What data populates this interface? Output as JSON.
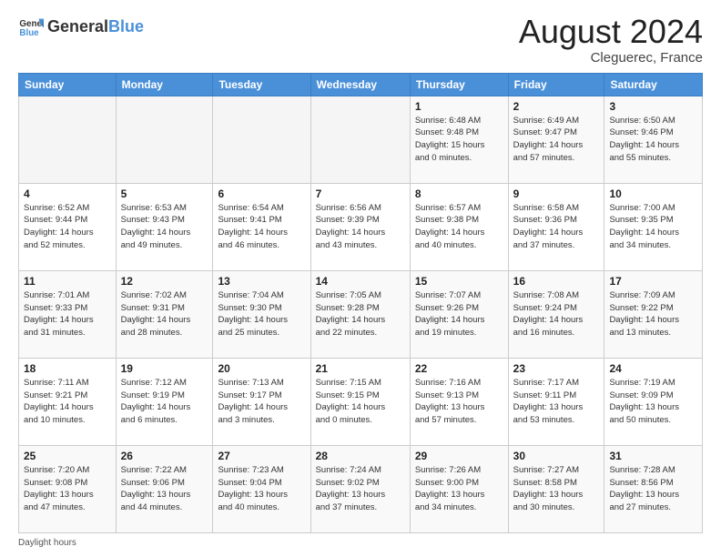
{
  "header": {
    "logo_general": "General",
    "logo_blue": "Blue",
    "month_year": "August 2024",
    "location": "Cleguerec, France"
  },
  "days_of_week": [
    "Sunday",
    "Monday",
    "Tuesday",
    "Wednesday",
    "Thursday",
    "Friday",
    "Saturday"
  ],
  "footer": {
    "daylight_label": "Daylight hours"
  },
  "weeks": [
    {
      "days": [
        {
          "num": "",
          "info": ""
        },
        {
          "num": "",
          "info": ""
        },
        {
          "num": "",
          "info": ""
        },
        {
          "num": "",
          "info": ""
        },
        {
          "num": "1",
          "info": "Sunrise: 6:48 AM\nSunset: 9:48 PM\nDaylight: 15 hours\nand 0 minutes."
        },
        {
          "num": "2",
          "info": "Sunrise: 6:49 AM\nSunset: 9:47 PM\nDaylight: 14 hours\nand 57 minutes."
        },
        {
          "num": "3",
          "info": "Sunrise: 6:50 AM\nSunset: 9:46 PM\nDaylight: 14 hours\nand 55 minutes."
        }
      ]
    },
    {
      "days": [
        {
          "num": "4",
          "info": "Sunrise: 6:52 AM\nSunset: 9:44 PM\nDaylight: 14 hours\nand 52 minutes."
        },
        {
          "num": "5",
          "info": "Sunrise: 6:53 AM\nSunset: 9:43 PM\nDaylight: 14 hours\nand 49 minutes."
        },
        {
          "num": "6",
          "info": "Sunrise: 6:54 AM\nSunset: 9:41 PM\nDaylight: 14 hours\nand 46 minutes."
        },
        {
          "num": "7",
          "info": "Sunrise: 6:56 AM\nSunset: 9:39 PM\nDaylight: 14 hours\nand 43 minutes."
        },
        {
          "num": "8",
          "info": "Sunrise: 6:57 AM\nSunset: 9:38 PM\nDaylight: 14 hours\nand 40 minutes."
        },
        {
          "num": "9",
          "info": "Sunrise: 6:58 AM\nSunset: 9:36 PM\nDaylight: 14 hours\nand 37 minutes."
        },
        {
          "num": "10",
          "info": "Sunrise: 7:00 AM\nSunset: 9:35 PM\nDaylight: 14 hours\nand 34 minutes."
        }
      ]
    },
    {
      "days": [
        {
          "num": "11",
          "info": "Sunrise: 7:01 AM\nSunset: 9:33 PM\nDaylight: 14 hours\nand 31 minutes."
        },
        {
          "num": "12",
          "info": "Sunrise: 7:02 AM\nSunset: 9:31 PM\nDaylight: 14 hours\nand 28 minutes."
        },
        {
          "num": "13",
          "info": "Sunrise: 7:04 AM\nSunset: 9:30 PM\nDaylight: 14 hours\nand 25 minutes."
        },
        {
          "num": "14",
          "info": "Sunrise: 7:05 AM\nSunset: 9:28 PM\nDaylight: 14 hours\nand 22 minutes."
        },
        {
          "num": "15",
          "info": "Sunrise: 7:07 AM\nSunset: 9:26 PM\nDaylight: 14 hours\nand 19 minutes."
        },
        {
          "num": "16",
          "info": "Sunrise: 7:08 AM\nSunset: 9:24 PM\nDaylight: 14 hours\nand 16 minutes."
        },
        {
          "num": "17",
          "info": "Sunrise: 7:09 AM\nSunset: 9:22 PM\nDaylight: 14 hours\nand 13 minutes."
        }
      ]
    },
    {
      "days": [
        {
          "num": "18",
          "info": "Sunrise: 7:11 AM\nSunset: 9:21 PM\nDaylight: 14 hours\nand 10 minutes."
        },
        {
          "num": "19",
          "info": "Sunrise: 7:12 AM\nSunset: 9:19 PM\nDaylight: 14 hours\nand 6 minutes."
        },
        {
          "num": "20",
          "info": "Sunrise: 7:13 AM\nSunset: 9:17 PM\nDaylight: 14 hours\nand 3 minutes."
        },
        {
          "num": "21",
          "info": "Sunrise: 7:15 AM\nSunset: 9:15 PM\nDaylight: 14 hours\nand 0 minutes."
        },
        {
          "num": "22",
          "info": "Sunrise: 7:16 AM\nSunset: 9:13 PM\nDaylight: 13 hours\nand 57 minutes."
        },
        {
          "num": "23",
          "info": "Sunrise: 7:17 AM\nSunset: 9:11 PM\nDaylight: 13 hours\nand 53 minutes."
        },
        {
          "num": "24",
          "info": "Sunrise: 7:19 AM\nSunset: 9:09 PM\nDaylight: 13 hours\nand 50 minutes."
        }
      ]
    },
    {
      "days": [
        {
          "num": "25",
          "info": "Sunrise: 7:20 AM\nSunset: 9:08 PM\nDaylight: 13 hours\nand 47 minutes."
        },
        {
          "num": "26",
          "info": "Sunrise: 7:22 AM\nSunset: 9:06 PM\nDaylight: 13 hours\nand 44 minutes."
        },
        {
          "num": "27",
          "info": "Sunrise: 7:23 AM\nSunset: 9:04 PM\nDaylight: 13 hours\nand 40 minutes."
        },
        {
          "num": "28",
          "info": "Sunrise: 7:24 AM\nSunset: 9:02 PM\nDaylight: 13 hours\nand 37 minutes."
        },
        {
          "num": "29",
          "info": "Sunrise: 7:26 AM\nSunset: 9:00 PM\nDaylight: 13 hours\nand 34 minutes."
        },
        {
          "num": "30",
          "info": "Sunrise: 7:27 AM\nSunset: 8:58 PM\nDaylight: 13 hours\nand 30 minutes."
        },
        {
          "num": "31",
          "info": "Sunrise: 7:28 AM\nSunset: 8:56 PM\nDaylight: 13 hours\nand 27 minutes."
        }
      ]
    }
  ]
}
